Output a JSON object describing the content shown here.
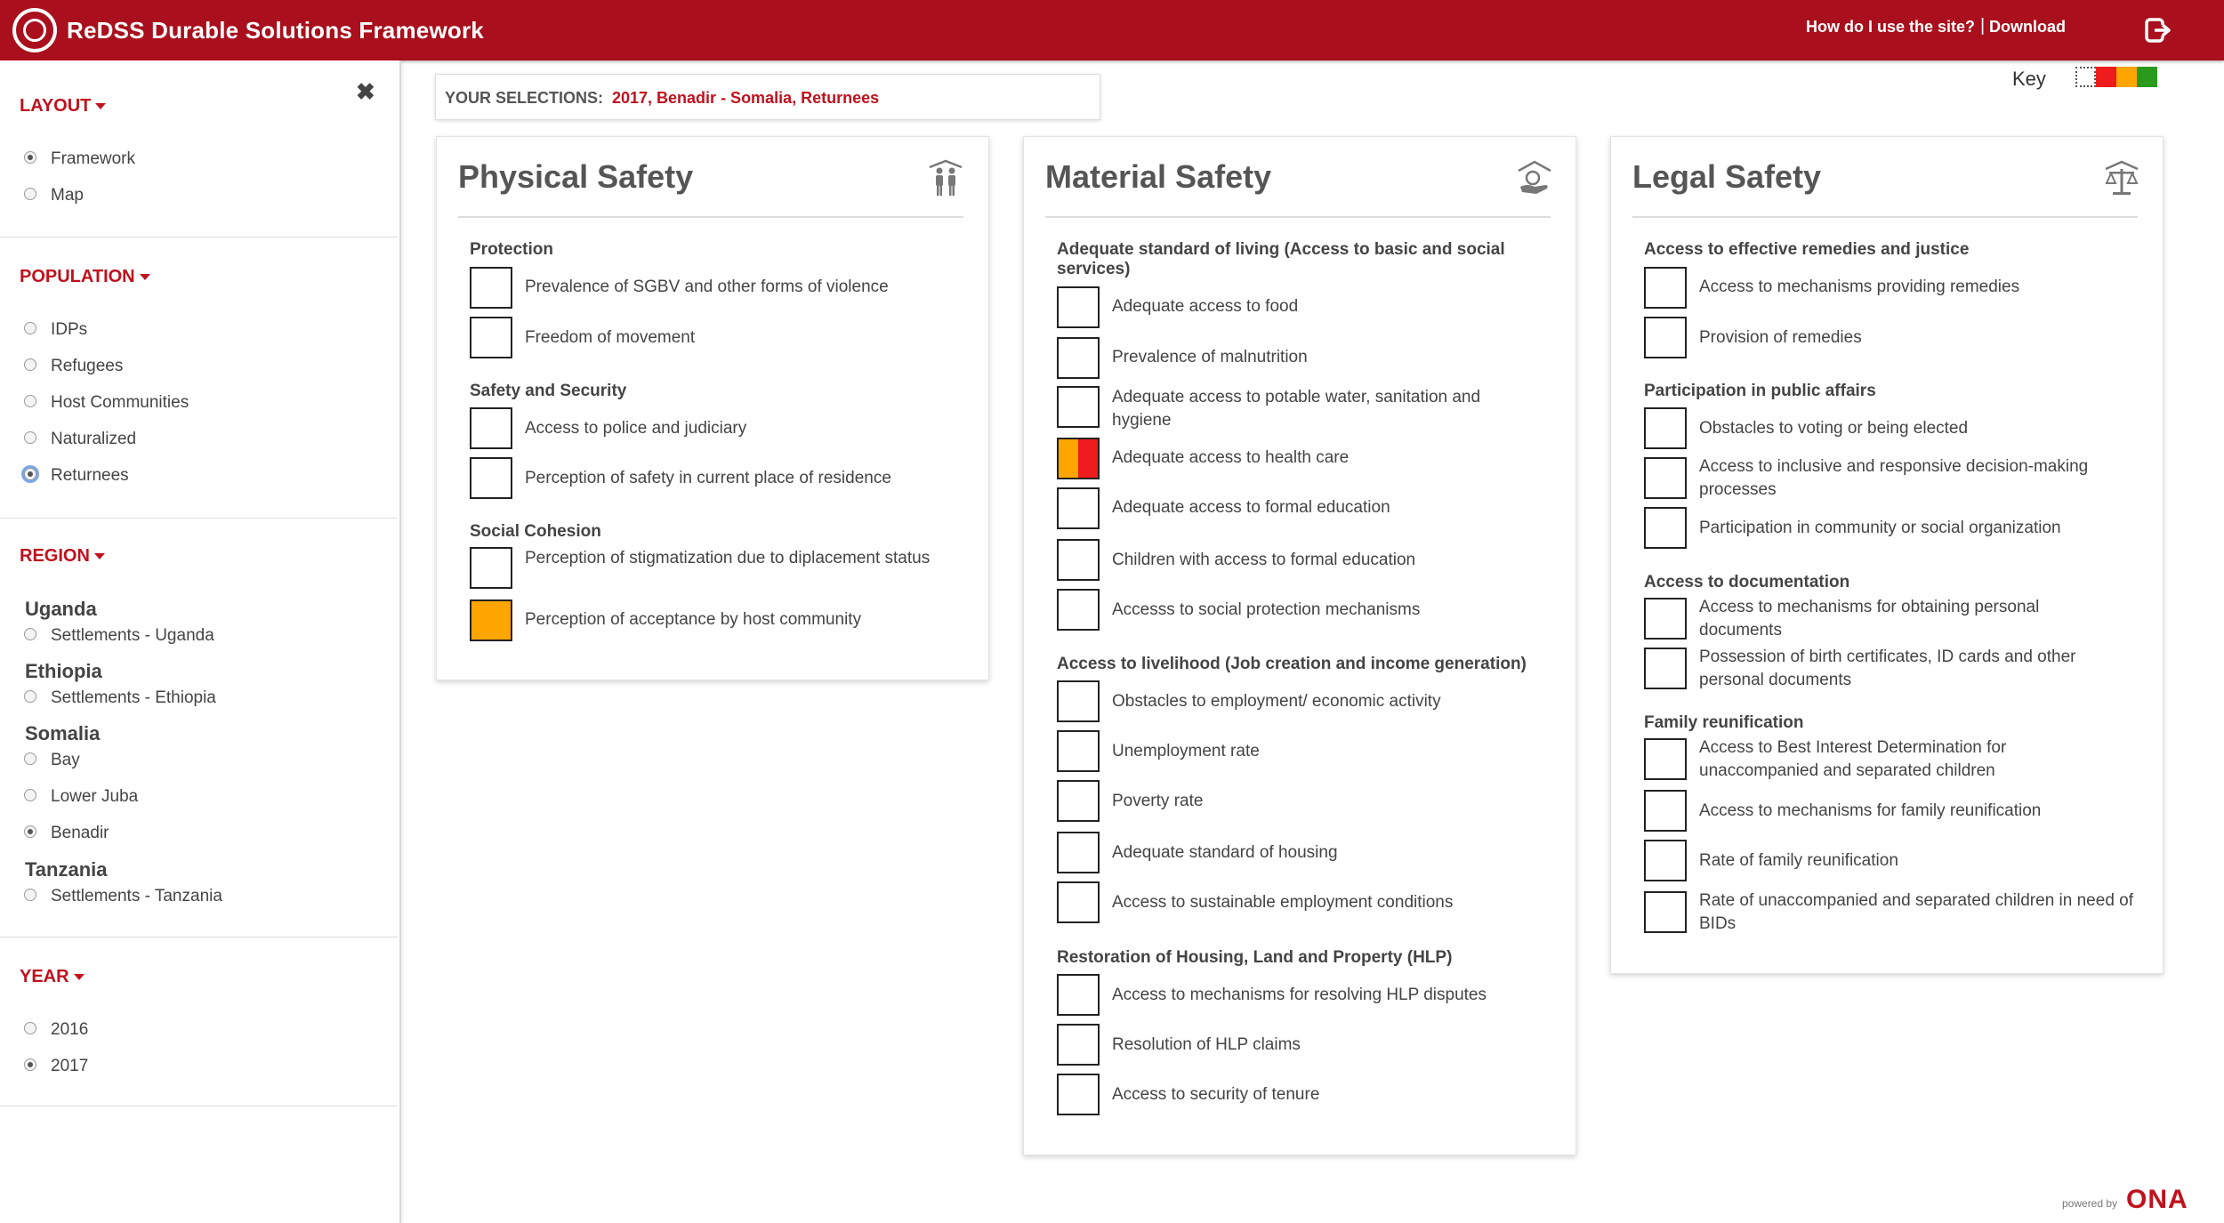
{
  "header": {
    "app_title": "ReDSS Durable Solutions Framework",
    "help_link": "How do I use the site?",
    "separator": "|",
    "download_link": "Download"
  },
  "sidebar": {
    "close_glyph": "✖",
    "layout": {
      "title": "LAYOUT",
      "options": [
        {
          "label": "Framework",
          "checked": true
        },
        {
          "label": "Map",
          "checked": false
        }
      ]
    },
    "population": {
      "title": "POPULATION",
      "options": [
        {
          "label": "IDPs",
          "checked": false
        },
        {
          "label": "Refugees",
          "checked": false
        },
        {
          "label": "Host Communities",
          "checked": false
        },
        {
          "label": "Naturalized",
          "checked": false
        },
        {
          "label": "Returnees",
          "checked": true
        }
      ]
    },
    "region": {
      "title": "REGION",
      "countries": [
        {
          "name": "Uganda",
          "areas": [
            {
              "label": "Settlements - Uganda",
              "checked": false
            }
          ]
        },
        {
          "name": "Ethiopia",
          "areas": [
            {
              "label": "Settlements - Ethiopia",
              "checked": false
            }
          ]
        },
        {
          "name": "Somalia",
          "areas": [
            {
              "label": "Bay",
              "checked": false
            },
            {
              "label": "Lower Juba",
              "checked": false
            },
            {
              "label": "Benadir",
              "checked": true
            }
          ]
        },
        {
          "name": "Tanzania",
          "areas": [
            {
              "label": "Settlements - Tanzania",
              "checked": false
            }
          ]
        }
      ]
    },
    "year": {
      "title": "YEAR",
      "options": [
        {
          "label": "2016",
          "checked": false
        },
        {
          "label": "2017",
          "checked": true
        }
      ]
    }
  },
  "selections": {
    "label": "YOUR SELECTIONS:",
    "value": "2017, Benadir - Somalia, Returnees"
  },
  "key": {
    "label": "Key",
    "colors": [
      "#ffffff",
      "#ee1c1c",
      "#ffa500",
      "#2a9a1c"
    ]
  },
  "panels": {
    "physical": {
      "title": "Physical Safety",
      "icon": "people-icon",
      "groups": [
        {
          "title": "Protection",
          "items": [
            {
              "label": "Prevalence of SGBV and other forms of violence",
              "status": "none"
            },
            {
              "label": "Freedom of movement",
              "status": "none"
            }
          ]
        },
        {
          "title": "Safety and Security",
          "items": [
            {
              "label": "Access to police and judiciary",
              "status": "none"
            },
            {
              "label": "Perception of safety in current place of residence",
              "status": "none"
            }
          ]
        },
        {
          "title": "Social Cohesion",
          "items": [
            {
              "label": "Perception of stigmatization due to diplacement status",
              "status": "none"
            },
            {
              "label": "Perception of acceptance by host community",
              "status": "orange"
            }
          ]
        }
      ]
    },
    "material": {
      "title": "Material Safety",
      "icon": "house-hand-icon",
      "groups": [
        {
          "title": "Adequate standard of living (Access to basic and social services)",
          "items": [
            {
              "label": "Adequate access to food",
              "status": "none"
            },
            {
              "label": "Prevalence of malnutrition",
              "status": "none"
            },
            {
              "label": "Adequate access to potable water, sanitation and hygiene",
              "status": "none"
            },
            {
              "label": "Adequate access to health care",
              "status": "orange-red"
            },
            {
              "label": "Adequate access to formal education",
              "status": "none"
            },
            {
              "label": "Children with access to formal education",
              "status": "none"
            },
            {
              "label": "Accesss to social protection mechanisms",
              "status": "none"
            }
          ]
        },
        {
          "title": "Access to livelihood (Job creation and income generation)",
          "items": [
            {
              "label": "Obstacles to employment/ economic activity",
              "status": "none"
            },
            {
              "label": "Unemployment rate",
              "status": "none"
            },
            {
              "label": "Poverty rate",
              "status": "none"
            },
            {
              "label": "Adequate standard of housing",
              "status": "none"
            },
            {
              "label": "Access to sustainable employment conditions",
              "status": "none"
            }
          ]
        },
        {
          "title": "Restoration of Housing, Land and Property (HLP)",
          "items": [
            {
              "label": "Access to mechanisms for resolving HLP disputes",
              "status": "none"
            },
            {
              "label": "Resolution of HLP claims",
              "status": "none"
            },
            {
              "label": "Access to security of tenure",
              "status": "none"
            }
          ]
        }
      ]
    },
    "legal": {
      "title": "Legal Safety",
      "icon": "scales-icon",
      "groups": [
        {
          "title": "Access to effective remedies and justice",
          "items": [
            {
              "label": "Access to mechanisms providing remedies",
              "status": "none"
            },
            {
              "label": "Provision of remedies",
              "status": "none"
            }
          ]
        },
        {
          "title": "Participation in public affairs",
          "items": [
            {
              "label": "Obstacles to voting or being elected",
              "status": "none"
            },
            {
              "label": "Access to inclusive and responsive decision-making processes",
              "status": "none"
            },
            {
              "label": "Participation in community or social organization",
              "status": "none"
            }
          ]
        },
        {
          "title": "Access to documentation",
          "items": [
            {
              "label": "Access to mechanisms for obtaining personal documents",
              "status": "none"
            },
            {
              "label": "Possession of birth certificates, ID cards and other personal documents",
              "status": "none"
            }
          ]
        },
        {
          "title": "Family reunification",
          "items": [
            {
              "label": "Access to Best Interest Determination for unaccompanied and separated children",
              "status": "none"
            },
            {
              "label": "Access to mechanisms for family reunification",
              "status": "none"
            },
            {
              "label": "Rate of family reunification",
              "status": "none"
            },
            {
              "label": "Rate of unaccompanied and separated children in need of BIDs",
              "status": "none"
            }
          ]
        }
      ]
    }
  },
  "footer": {
    "powered_by": "powered by",
    "brand": "ONA"
  }
}
